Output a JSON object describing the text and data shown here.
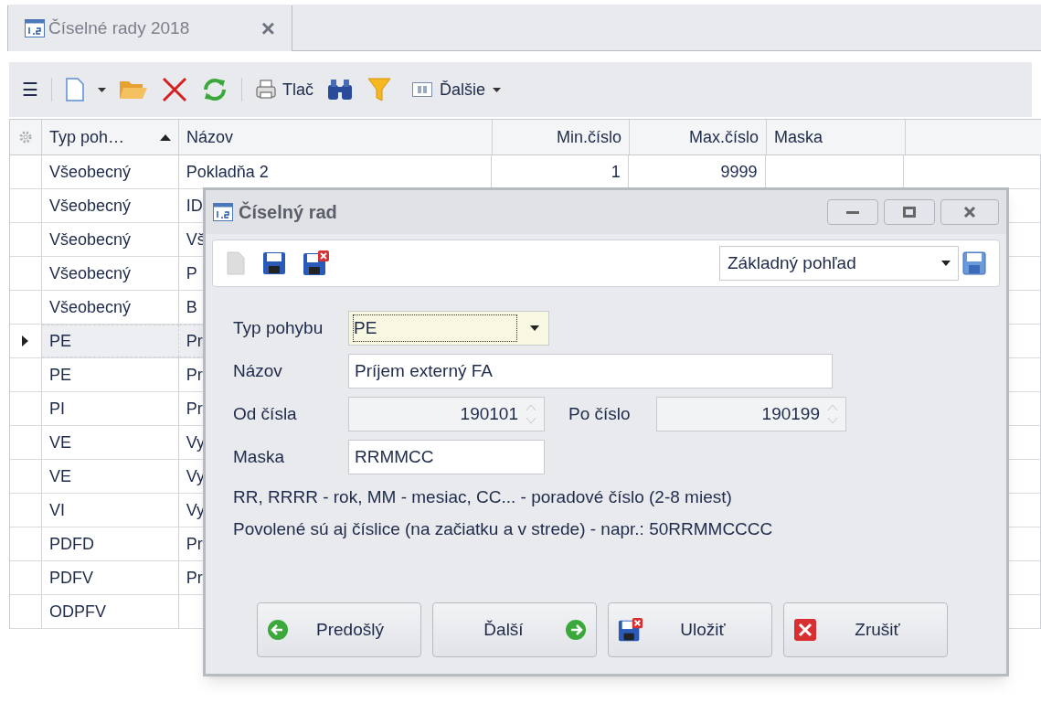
{
  "tab": {
    "title": "Číselné rady 2018",
    "close": "×"
  },
  "toolbar": {
    "menu": "☰",
    "print": "Tlač",
    "more": "Ďalšie"
  },
  "table": {
    "columns": [
      {
        "label": "Typ poh…",
        "sorted": true
      },
      {
        "label": "Názov",
        "sorted": false
      },
      {
        "label": "Min.číslo",
        "sorted": false
      },
      {
        "label": "Max.číslo",
        "sorted": false
      },
      {
        "label": "Maska",
        "sorted": false
      }
    ],
    "rows": [
      {
        "type": "Všeobecný",
        "name": "Pokladňa 2",
        "min": "1",
        "max": "9999",
        "selected": false
      },
      {
        "type": "Všeobecný",
        "name": "ID",
        "selected": false
      },
      {
        "type": "Všeobecný",
        "name": "Vš",
        "selected": false
      },
      {
        "type": "Všeobecný",
        "name": "P",
        "selected": false
      },
      {
        "type": "Všeobecný",
        "name": "B",
        "selected": false
      },
      {
        "type": "PE",
        "name": "Pr",
        "selected": true
      },
      {
        "type": "PE",
        "name": "Pr",
        "selected": false
      },
      {
        "type": "PI",
        "name": "Pr",
        "selected": false
      },
      {
        "type": "VE",
        "name": "Vy",
        "selected": false
      },
      {
        "type": "VE",
        "name": "Vy",
        "selected": false
      },
      {
        "type": "VI",
        "name": "Vy",
        "selected": false
      },
      {
        "type": "PDFD",
        "name": "Pr",
        "selected": false
      },
      {
        "type": "PDFV",
        "name": "Pr",
        "selected": false
      },
      {
        "type": "ODPFV",
        "selected": false
      }
    ]
  },
  "dialog": {
    "title": "Číselný rad",
    "view": "Základný pohľad",
    "fields": {
      "type_label": "Typ pohybu",
      "type_value": "PE",
      "name_label": "Názov",
      "name_value": "Príjem externý FA",
      "from_label": "Od čísla",
      "from_value": "190101",
      "to_label": "Po číslo",
      "to_value": "190199",
      "mask_label": "Maska",
      "mask_value": "RRMMCC"
    },
    "hints": [
      "RR, RRRR - rok, MM - mesiac, CC... - poradové číslo (2-8 miest)",
      "Povolené sú aj číslice (na začiatku a v strede) - napr.: 50RRMMCCCC"
    ],
    "buttons": [
      {
        "kind": "prev",
        "label": "Predošlý"
      },
      {
        "kind": "next",
        "label": "Ďalší"
      },
      {
        "kind": "save",
        "label": "Uložiť"
      },
      {
        "kind": "cancel",
        "label": "Zrušiť"
      }
    ]
  }
}
